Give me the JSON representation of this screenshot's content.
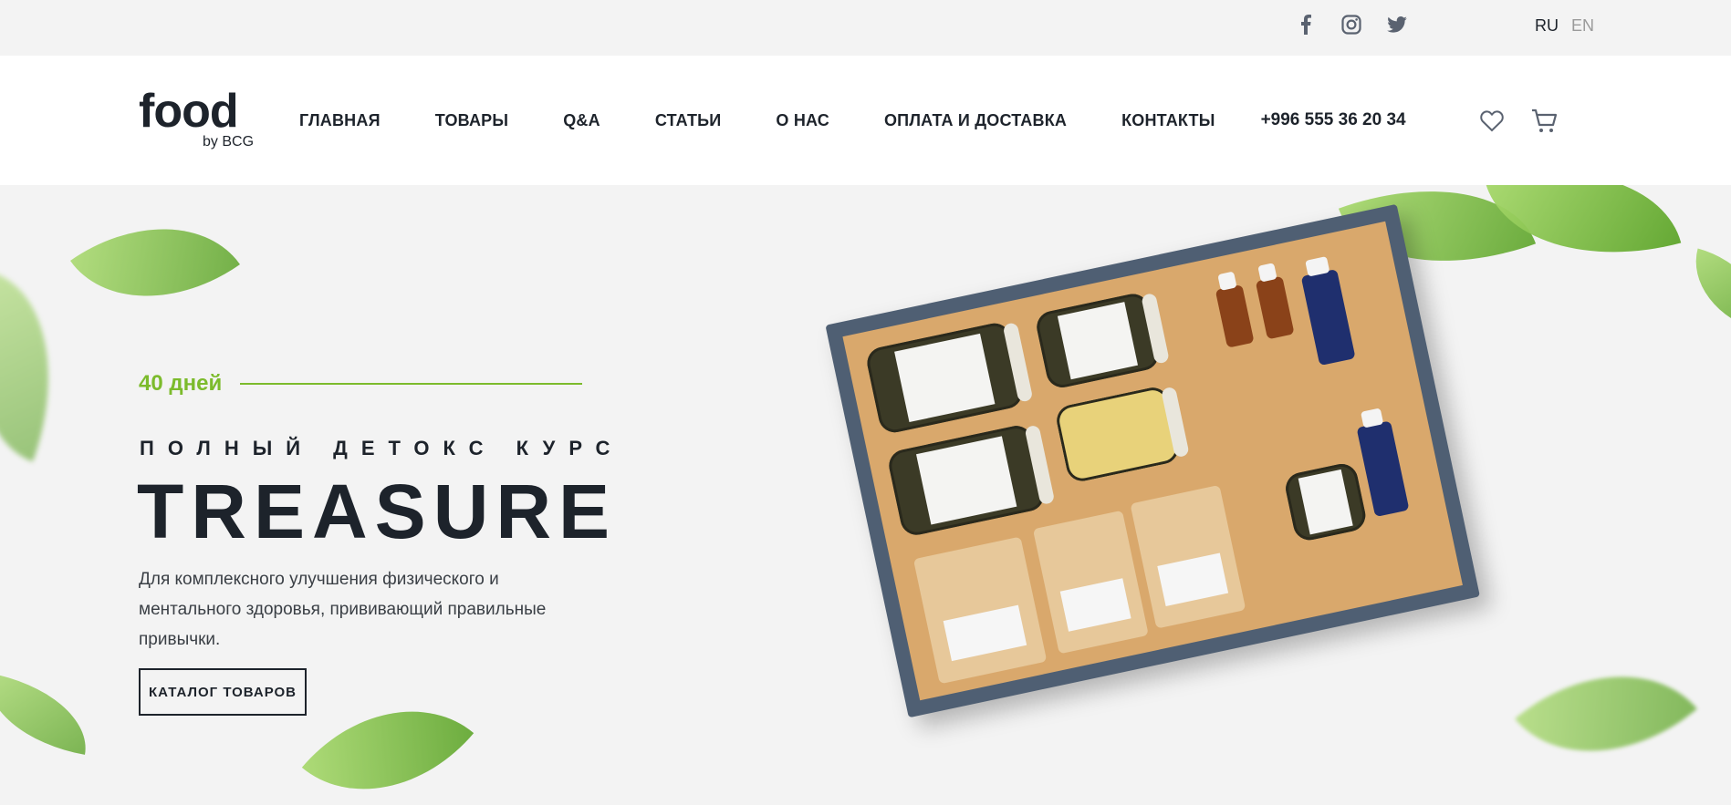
{
  "topbar": {
    "social": [
      {
        "icon": "facebook-icon"
      },
      {
        "icon": "instagram-icon"
      },
      {
        "icon": "twitter-icon"
      }
    ],
    "languages": [
      {
        "code": "RU",
        "active": true
      },
      {
        "code": "EN",
        "active": false
      }
    ]
  },
  "header": {
    "logo": {
      "mark": "food",
      "by": "by BCG"
    },
    "nav": [
      "ГЛАВНАЯ",
      "ТОВАРЫ",
      "Q&A",
      "СТАТЬИ",
      "О НАС",
      "ОПЛАТА И ДОСТАВКА",
      "КОНТАКТЫ"
    ],
    "phone": "+996 555 36 20 34",
    "icons": [
      "heart-icon",
      "cart-icon"
    ]
  },
  "hero": {
    "days": "40 дней",
    "subtitle": "ПОЛНЫЙ ДЕТОКС КУРС",
    "title": "TREASURE",
    "description": "Для комплексного улучшения физического и ментального здоровья, прививающий правильные привычки.",
    "cta": "КАТАЛОГ ТОВАРОВ"
  },
  "colors": {
    "accent_green": "#7cbb2c",
    "text_dark": "#1d232b",
    "page_bg": "#f3f3f3"
  }
}
